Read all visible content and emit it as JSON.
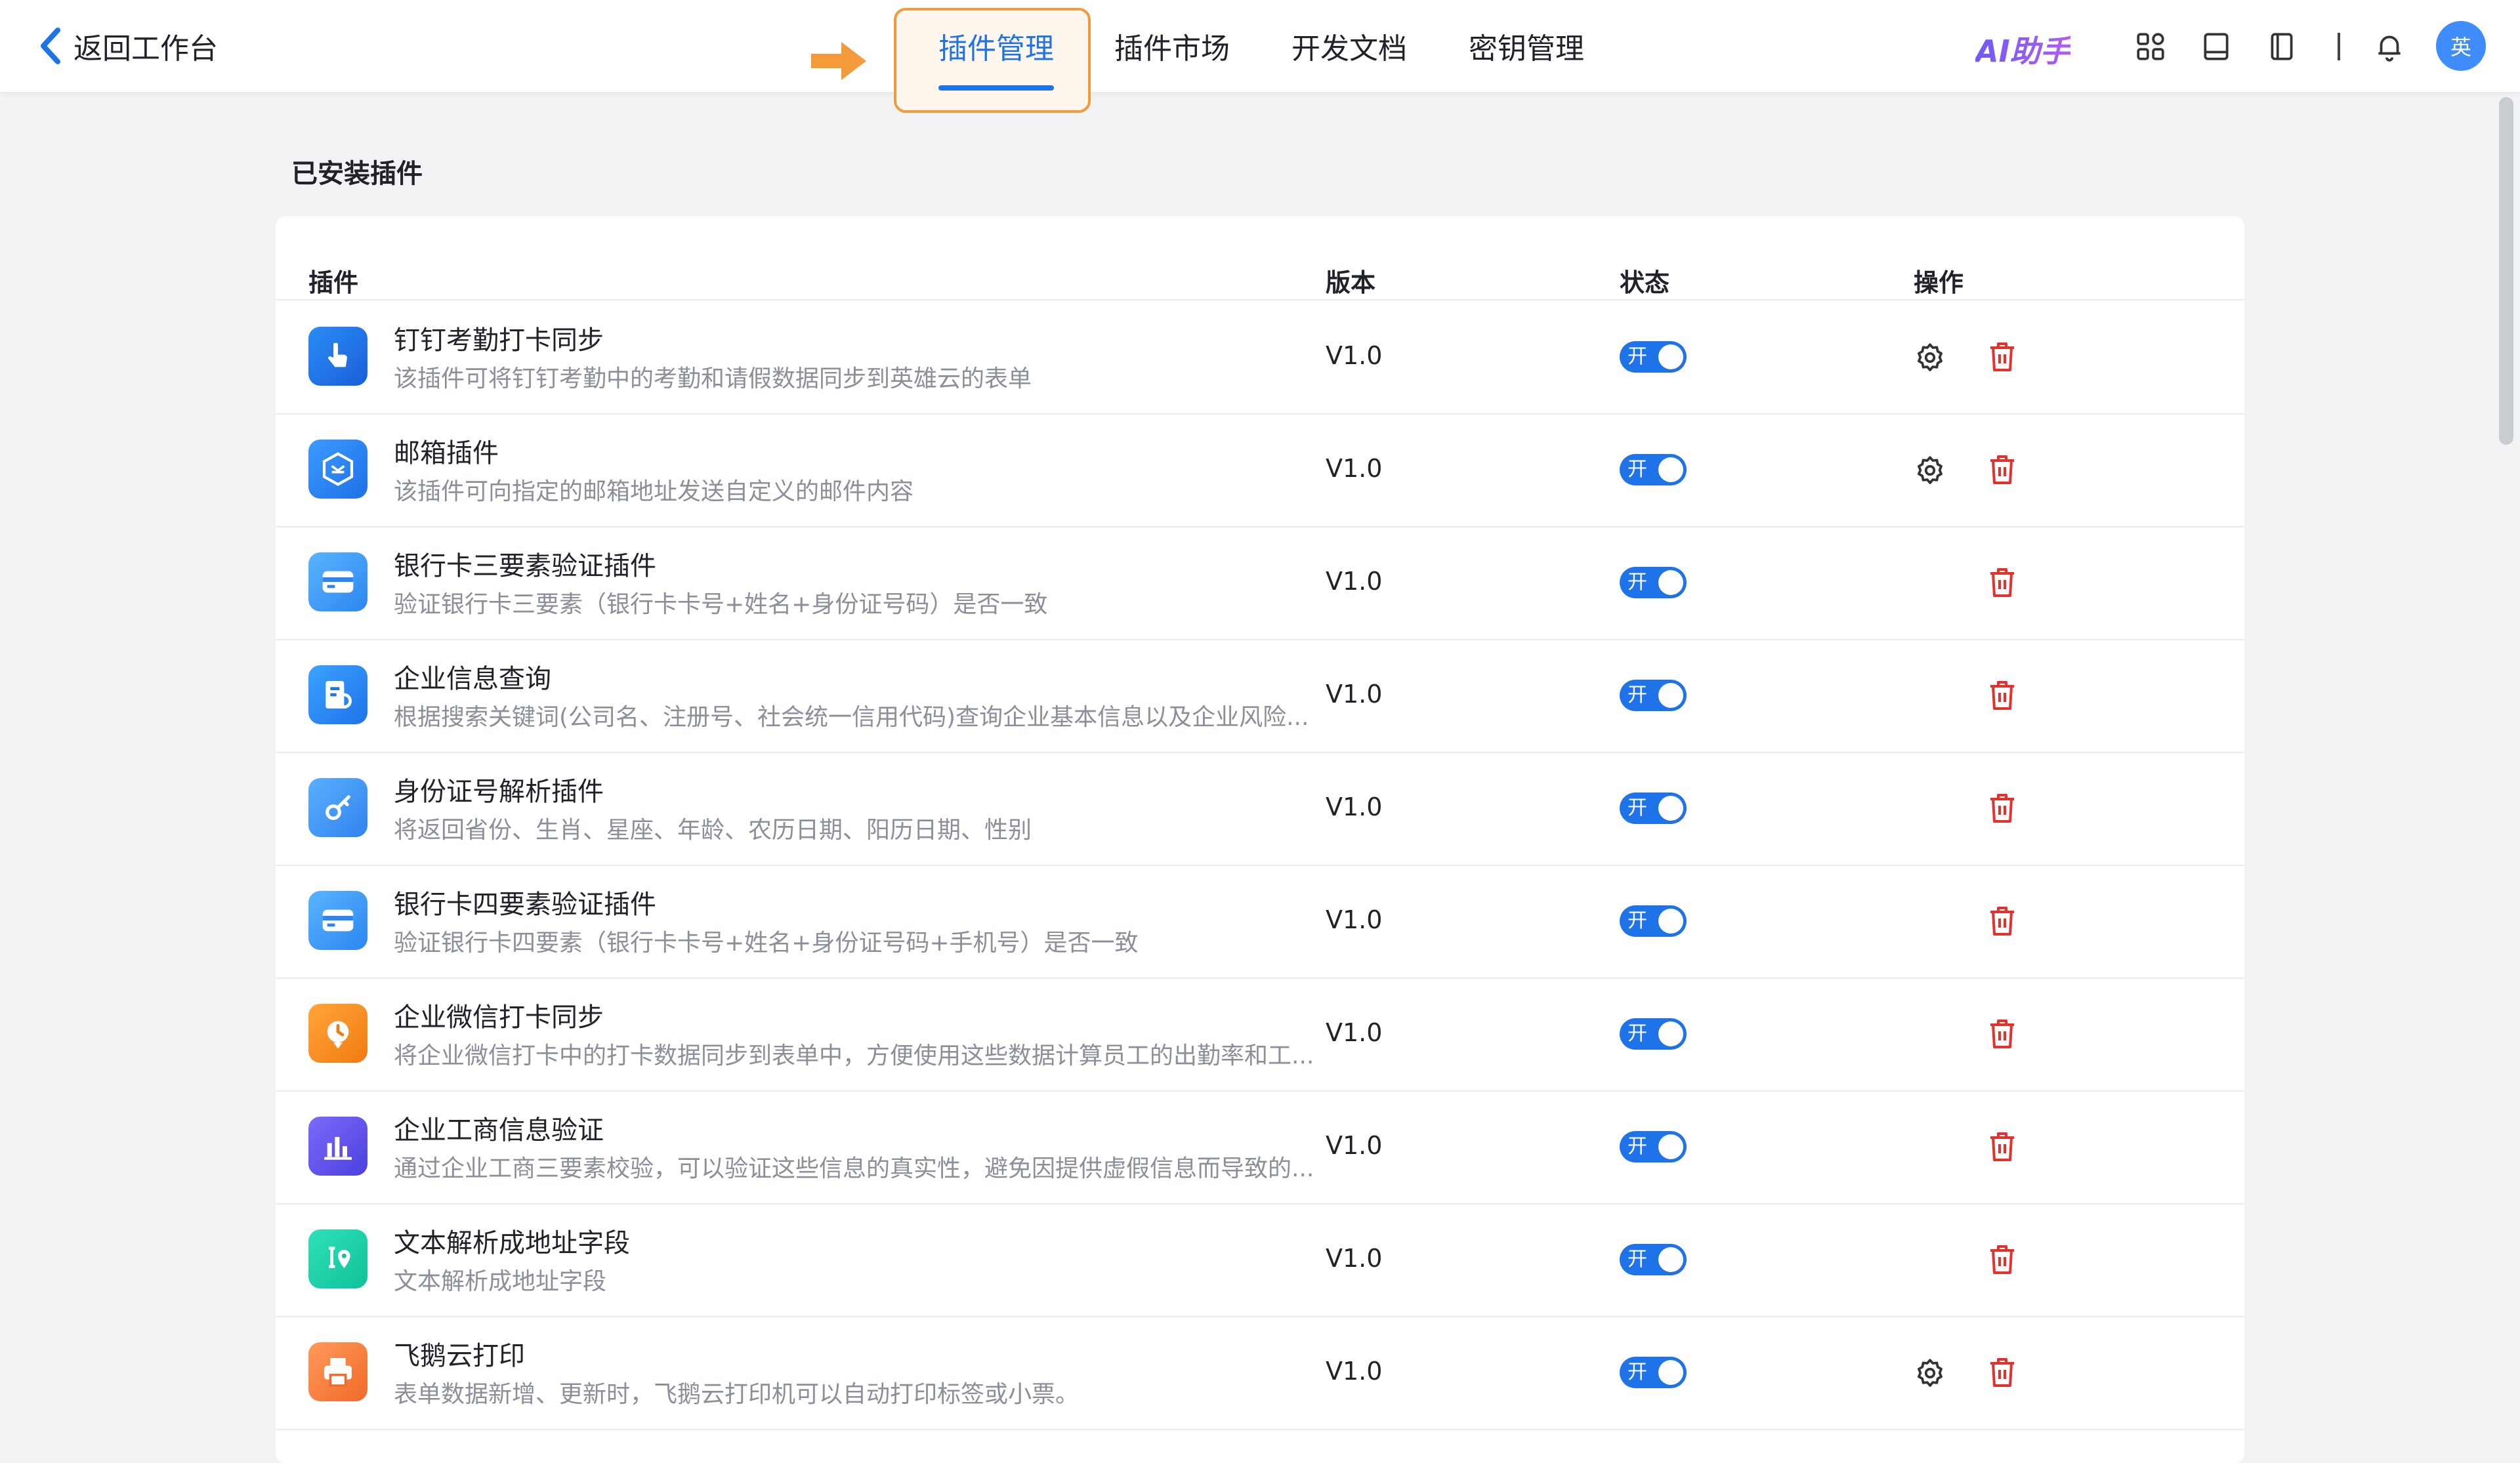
{
  "header": {
    "back_label": "返回工作台",
    "tabs": [
      {
        "label": "插件管理",
        "active": true
      },
      {
        "label": "插件市场",
        "active": false
      },
      {
        "label": "开发文档",
        "active": false
      },
      {
        "label": "密钥管理",
        "active": false
      }
    ],
    "ai_label": "AI助手",
    "avatar_text": "英",
    "accent_color": "#1f73e8",
    "highlight_color": "#f39a3a"
  },
  "section": {
    "title": "已安装插件"
  },
  "table": {
    "columns": {
      "plugin": "插件",
      "version": "版本",
      "status": "状态",
      "actions": "操作"
    },
    "toggle_on_label": "开",
    "rows": [
      {
        "name": "钉钉考勤打卡同步",
        "desc": "该插件可将钉钉考勤中的考勤和请假数据同步到英雄云的表单",
        "version": "V1.0",
        "icon": "dingtalk-icon",
        "has_settings": true
      },
      {
        "name": "邮箱插件",
        "desc": "该插件可向指定的邮箱地址发送自定义的邮件内容",
        "version": "V1.0",
        "icon": "mailbox-icon",
        "has_settings": true
      },
      {
        "name": "银行卡三要素验证插件",
        "desc": "验证银行卡三要素（银行卡卡号+姓名+身份证号码）是否一致",
        "version": "V1.0",
        "icon": "bank-card-icon",
        "has_settings": false
      },
      {
        "name": "企业信息查询",
        "desc": "根据搜索关键词(公司名、注册号、社会统一信用代码)查询企业基本信息以及企业风险...",
        "version": "V1.0",
        "icon": "company-search-icon",
        "has_settings": false
      },
      {
        "name": "身份证号解析插件",
        "desc": "将返回省份、生肖、星座、年龄、农历日期、阳历日期、性别",
        "version": "V1.0",
        "icon": "id-key-icon",
        "has_settings": false
      },
      {
        "name": "银行卡四要素验证插件",
        "desc": "验证银行卡四要素（银行卡卡号+姓名+身份证号码+手机号）是否一致",
        "version": "V1.0",
        "icon": "bank-card-icon",
        "has_settings": false
      },
      {
        "name": "企业微信打卡同步",
        "desc": "将企业微信打卡中的打卡数据同步到表单中，方便使用这些数据计算员工的出勤率和工...",
        "version": "V1.0",
        "icon": "wecom-clock-icon",
        "has_settings": false
      },
      {
        "name": "企业工商信息验证",
        "desc": "通过企业工商三要素校验，可以验证这些信息的真实性，避免因提供虚假信息而导致的...",
        "version": "V1.0",
        "icon": "business-chart-icon",
        "has_settings": false
      },
      {
        "name": "文本解析成地址字段",
        "desc": "文本解析成地址字段",
        "version": "V1.0",
        "icon": "address-parse-icon",
        "has_settings": false
      },
      {
        "name": "飞鹅云打印",
        "desc": "表单数据新增、更新时，飞鹅云打印机可以自动打印标签或小票。",
        "version": "V1.0",
        "icon": "printer-icon",
        "has_settings": true
      }
    ]
  }
}
